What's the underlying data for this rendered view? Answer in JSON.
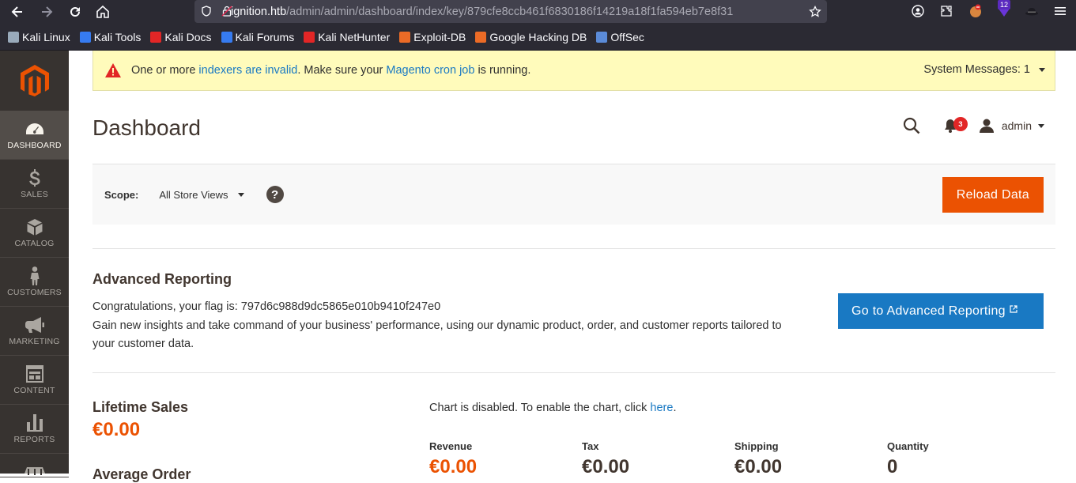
{
  "browser": {
    "url_host": "ignition.htb",
    "url_path": "/admin/admin/dashboard/index/key/879cfe8ccb461f6830186f14219a18f1fa594eb7e8f31",
    "extension_badge": "12"
  },
  "bookmarks": [
    {
      "label": "Kali Linux",
      "color": "#9ab"
    },
    {
      "label": "Kali Tools",
      "color": "#367bf0"
    },
    {
      "label": "Kali Docs",
      "color": "#e22626"
    },
    {
      "label": "Kali Forums",
      "color": "#367bf0"
    },
    {
      "label": "Kali NetHunter",
      "color": "#e22626"
    },
    {
      "label": "Exploit-DB",
      "color": "#ec6b26"
    },
    {
      "label": "Google Hacking DB",
      "color": "#ec6b26"
    },
    {
      "label": "OffSec",
      "color": "#5b8bd8"
    }
  ],
  "sidebar": {
    "items": [
      {
        "label": "DASHBOARD",
        "icon": "dashboard-icon",
        "active": true
      },
      {
        "label": "SALES",
        "icon": "dollar-icon"
      },
      {
        "label": "CATALOG",
        "icon": "box-icon"
      },
      {
        "label": "CUSTOMERS",
        "icon": "person-icon"
      },
      {
        "label": "MARKETING",
        "icon": "megaphone-icon"
      },
      {
        "label": "CONTENT",
        "icon": "layout-icon"
      },
      {
        "label": "REPORTS",
        "icon": "bar-chart-icon"
      }
    ]
  },
  "system_message": {
    "prefix": "One or more ",
    "link1": "indexers are invalid",
    "middle": ". Make sure your ",
    "link2": "Magento cron job",
    "suffix": " is running.",
    "counter": "System Messages: 1"
  },
  "header": {
    "title": "Dashboard",
    "notifications": "3",
    "user": "admin"
  },
  "scope": {
    "label": "Scope:",
    "value": "All Store Views",
    "help": "?",
    "reload": "Reload Data"
  },
  "advanced_reporting": {
    "title": "Advanced Reporting",
    "line1": "Congratulations, your flag is: 797d6c988d9dc5865e010b9410f247e0",
    "line2": "Gain new insights and take command of your business' performance, using our dynamic product, order, and customer reports tailored to your customer data.",
    "button": "Go to Advanced Reporting"
  },
  "lifetime_sales": {
    "title": "Lifetime Sales",
    "value": "€0.00"
  },
  "average_order": {
    "title": "Average Order"
  },
  "chart": {
    "message": "Chart is disabled. To enable the chart, click ",
    "link": "here",
    "suffix": "."
  },
  "totals": [
    {
      "label": "Revenue",
      "value": "€0.00",
      "orange": true
    },
    {
      "label": "Tax",
      "value": "€0.00"
    },
    {
      "label": "Shipping",
      "value": "€0.00"
    },
    {
      "label": "Quantity",
      "value": "0"
    }
  ]
}
